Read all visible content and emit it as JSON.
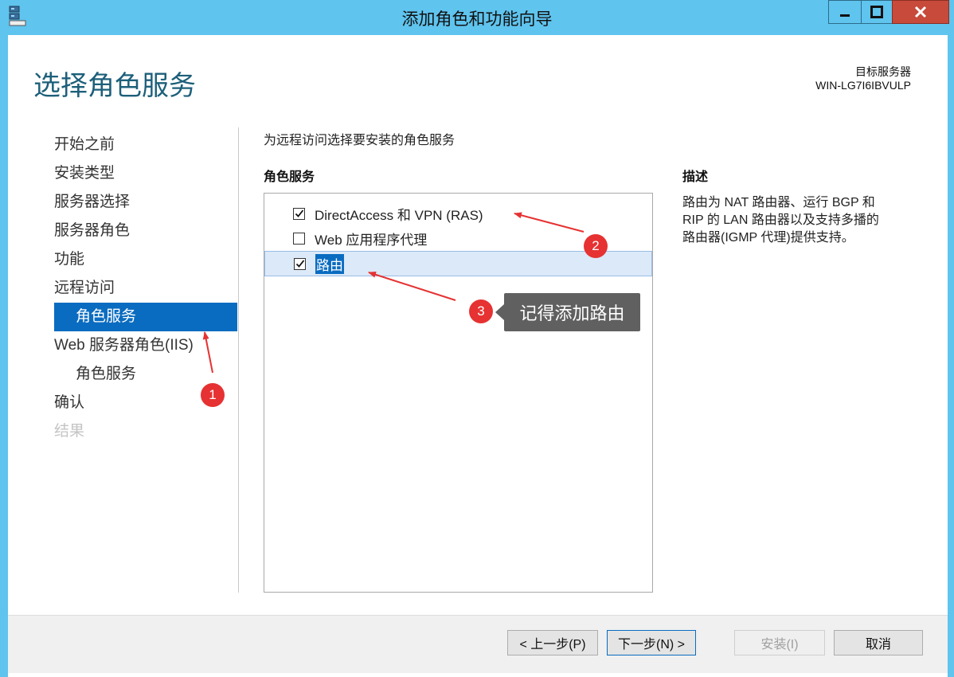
{
  "window": {
    "title": "添加角色和功能向导"
  },
  "header": {
    "page_title": "选择角色服务",
    "target_label": "目标服务器",
    "target_value": "WIN-LG7I6IBVULP"
  },
  "nav": {
    "items": [
      {
        "label": "开始之前"
      },
      {
        "label": "安装类型"
      },
      {
        "label": "服务器选择"
      },
      {
        "label": "服务器角色"
      },
      {
        "label": "功能"
      },
      {
        "label": "远程访问"
      },
      {
        "label": "角色服务"
      },
      {
        "label": "Web 服务器角色(IIS)"
      },
      {
        "label": "角色服务"
      },
      {
        "label": "确认"
      },
      {
        "label": "结果"
      }
    ]
  },
  "main": {
    "instruction": "为远程访问选择要安装的角色服务",
    "roles_header": "角色服务",
    "roles": [
      {
        "label": "DirectAccess 和 VPN (RAS)",
        "checked": true
      },
      {
        "label": "Web 应用程序代理",
        "checked": false
      },
      {
        "label": "路由",
        "checked": true
      }
    ],
    "desc_header": "描述",
    "desc_lines": [
      "路由为 NAT 路由器、运行 BGP 和",
      "RIP 的 LAN 路由器以及支持多播的",
      "路由器(IGMP 代理)提供支持。"
    ]
  },
  "buttons": {
    "prev": "< 上一步(P)",
    "next": "下一步(N) >",
    "install": "安装(I)",
    "cancel": "取消"
  },
  "annotations": {
    "badge1": "1",
    "badge2": "2",
    "badge3": "3",
    "callout": "记得添加路由"
  },
  "colors": {
    "titlebar": "#5fc4ee",
    "accent": "#0a6cc0",
    "annotation_red": "#e63232",
    "callout_bg": "#606060"
  }
}
